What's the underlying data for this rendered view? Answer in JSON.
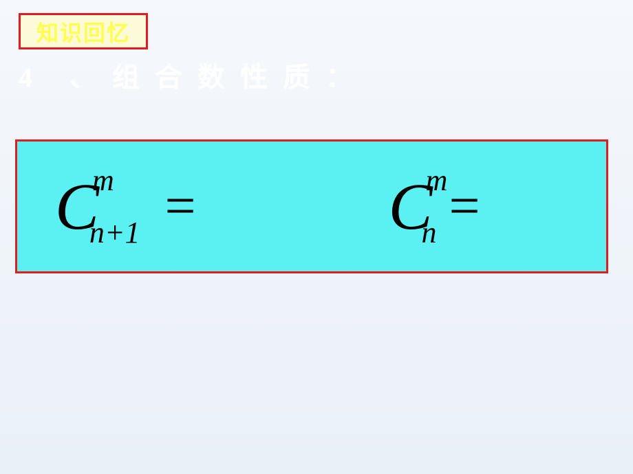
{
  "tag": {
    "label": "知识回忆"
  },
  "heading": {
    "text": "4 、组合数性质："
  },
  "formula": {
    "left": {
      "base": "C",
      "sup": "m",
      "sub": "n+1",
      "eq": "="
    },
    "right": {
      "base": "C",
      "sup": "m",
      "sub": "n",
      "eq": "="
    }
  },
  "chart_data": {
    "type": "table",
    "title": "组合数性质 (Combination Number Properties)",
    "equations": [
      {
        "lhs": "C(n+1, m)",
        "rhs": ""
      },
      {
        "lhs": "C(n, m)",
        "rhs": ""
      }
    ]
  }
}
